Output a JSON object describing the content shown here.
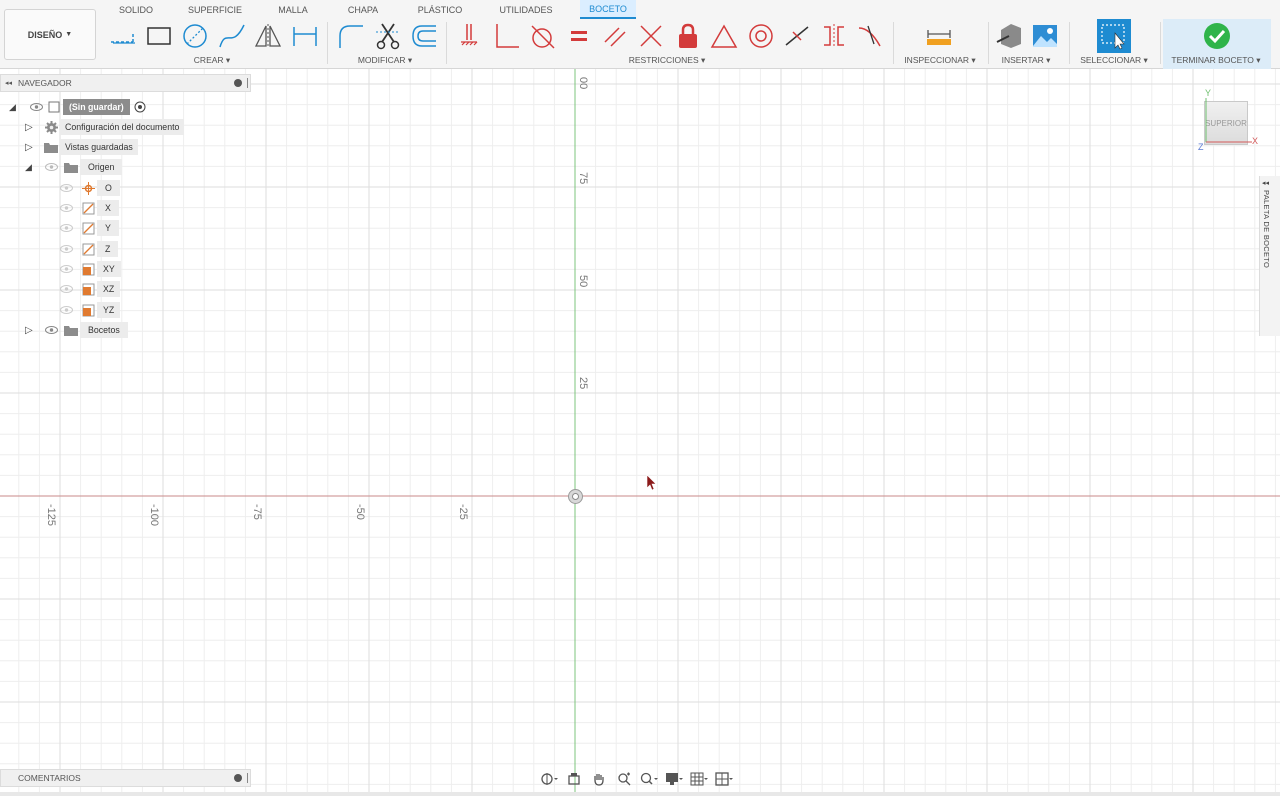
{
  "workspace": {
    "label": "DISEÑO"
  },
  "tabs": [
    "SOLIDO",
    "SUPERFICIE",
    "MALLA",
    "CHAPA",
    "PLÁSTICO",
    "UTILIDADES",
    "BOCETO"
  ],
  "active_tab": "BOCETO",
  "groups": {
    "crear": "CREAR",
    "modificar": "MODIFICAR",
    "restricciones": "RESTRICCIONES",
    "inspeccionar": "INSPECCIONAR",
    "insertar": "INSERTAR",
    "seleccionar": "SELECCIONAR",
    "terminar": "TERMINAR BOCETO"
  },
  "navigator": {
    "title": "NAVEGADOR",
    "root": "(Sin guardar)",
    "items": {
      "config": "Configuración del documento",
      "views": "Vistas guardadas",
      "origin": "Origen",
      "o": "O",
      "x": "X",
      "y": "Y",
      "z": "Z",
      "xy": "XY",
      "xz": "XZ",
      "yz": "YZ",
      "sketches": "Bocetos"
    }
  },
  "axis_labels": {
    "y": [
      "00",
      "75",
      "50",
      "25"
    ],
    "x": [
      "-125",
      "-100",
      "-75",
      "-50",
      "-25"
    ]
  },
  "viewcube": {
    "face": "SUPERIOR",
    "axis_x": "X",
    "axis_y": "Y",
    "axis_z": "Z"
  },
  "palette": {
    "label": "PALETA DE BOCETO"
  },
  "comments": {
    "label": "COMENTARIOS"
  },
  "colors": {
    "accent": "#1e8bd1",
    "constraint": "#d33b3b",
    "x_axis": "#c87a7a",
    "y_axis": "#6fbf6f",
    "grid": "#e6e6e6"
  }
}
